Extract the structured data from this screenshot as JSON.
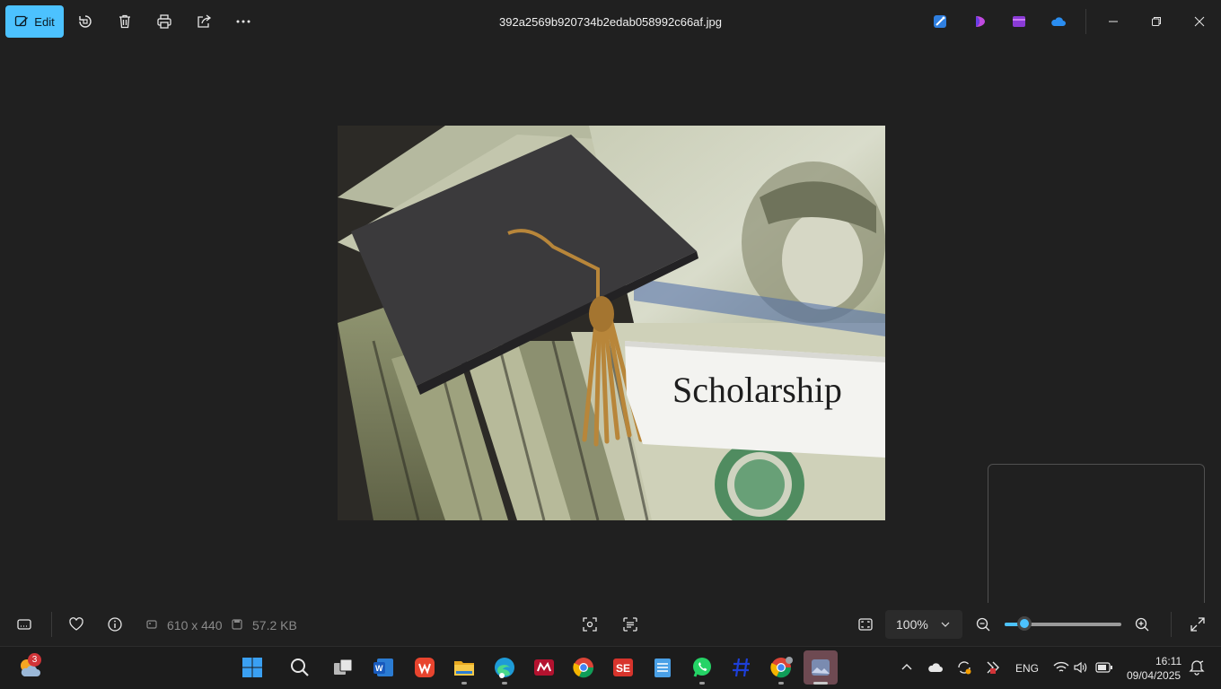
{
  "toolbar": {
    "edit_label": "Edit",
    "icons": [
      "rotate-icon",
      "delete-icon",
      "print-icon",
      "share-icon",
      "more-icon"
    ]
  },
  "title": "392a2569b920734b2edab058992c66af.jpg",
  "image": {
    "caption_text": "Scholarship"
  },
  "info_bar": {
    "dimensions": "610 x 440",
    "file_size": "57.2 KB",
    "zoom": "100%"
  },
  "taskbar": {
    "weather_badge": "3",
    "tray_language": "ENG",
    "time": "16:11",
    "date": "09/04/2025"
  },
  "colors": {
    "accent": "#4cc2ff",
    "background": "#202020"
  }
}
